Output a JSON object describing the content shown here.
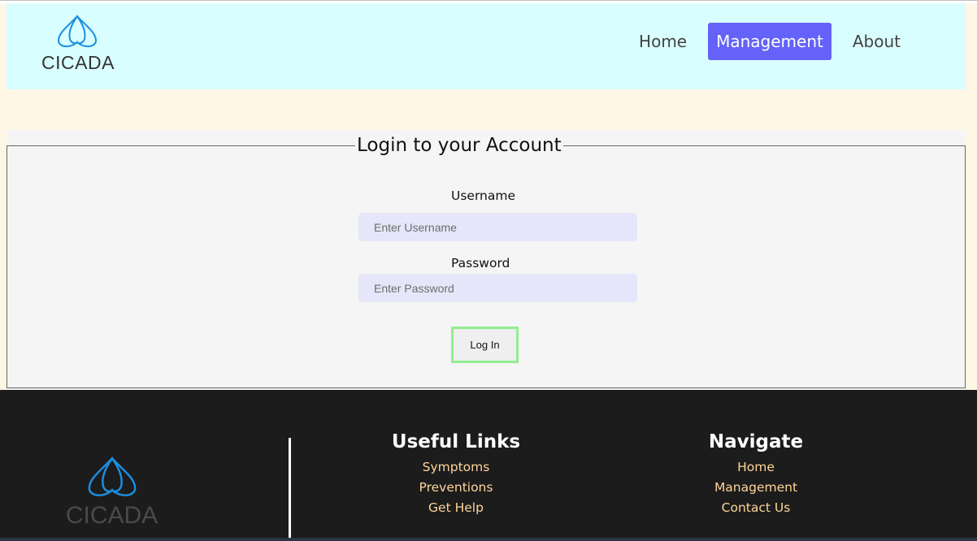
{
  "brand": {
    "name": "CICADA"
  },
  "nav": {
    "items": [
      {
        "label": "Home",
        "active": false
      },
      {
        "label": "Management",
        "active": true
      },
      {
        "label": "About",
        "active": false
      }
    ]
  },
  "login": {
    "title": "Login to your Account",
    "username_label": "Username",
    "username_placeholder": "Enter Username",
    "username_value": "",
    "password_label": "Password",
    "password_placeholder": "Enter Password",
    "password_value": "",
    "submit_label": "Log In"
  },
  "footer": {
    "brand_name": "CICADA",
    "useful_links": {
      "title": "Useful Links",
      "links": [
        "Symptoms",
        "Preventions",
        "Get Help"
      ]
    },
    "navigate": {
      "title": "Navigate",
      "links": [
        "Home",
        "Management",
        "Contact Us"
      ]
    }
  },
  "colors": {
    "page_bg": "#fff7e6",
    "header_bg": "#d9feff",
    "accent": "#6462f9",
    "input_bg": "#e6e6fa",
    "button_border": "#90ee90",
    "footer_bg": "#1c1c1c",
    "footer_link": "#ffd59a",
    "logo_blue": "#1b8fe0"
  },
  "icons": {
    "logo": "cicada-wings-logo-icon"
  }
}
